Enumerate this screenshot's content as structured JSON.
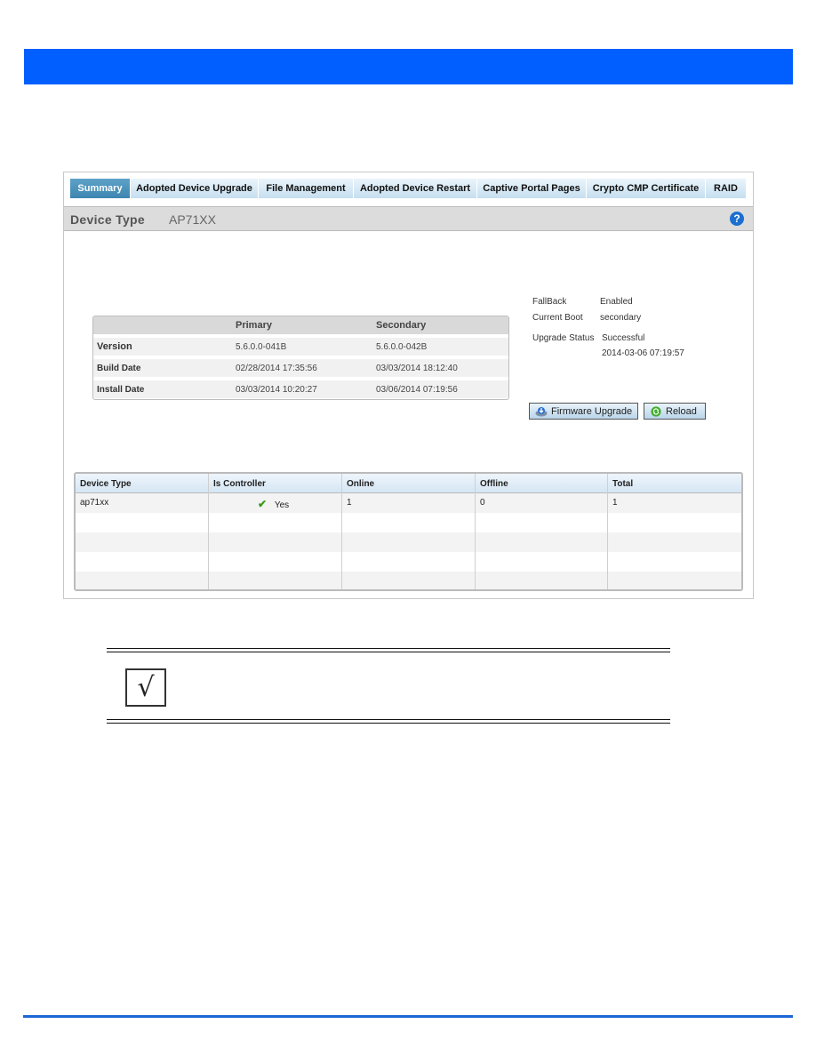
{
  "colors": {
    "header_bar": "#005ffe",
    "footer_rule": "#1c66d6",
    "active_tab": "#3d85b0",
    "help_icon": "#1b6fd1",
    "check_green": "#3a9a1c"
  },
  "tabs": [
    {
      "label": "Summary",
      "active": true
    },
    {
      "label": "Adopted Device Upgrade",
      "active": false
    },
    {
      "label": "File Management",
      "active": false
    },
    {
      "label": "Adopted Device Restart",
      "active": false
    },
    {
      "label": "Captive Portal Pages",
      "active": false
    },
    {
      "label": "Crypto CMP Certificate",
      "active": false
    },
    {
      "label": "RAID",
      "active": false
    }
  ],
  "device_header": {
    "label": "Device Type",
    "value": "AP71XX",
    "help_icon": "question-circle-icon"
  },
  "versions_table": {
    "columns": [
      "",
      "Primary",
      "Secondary"
    ],
    "rows": [
      [
        "Version",
        "5.6.0.0-041B",
        "5.6.0.0-042B"
      ],
      [
        "Build Date",
        "02/28/2014 17:35:56",
        "03/03/2014 18:12:40"
      ],
      [
        "Install Date",
        "03/03/2014 10:20:27",
        "03/06/2014 07:19:56"
      ]
    ]
  },
  "status": {
    "fallback_label": "FallBack",
    "fallback_value": "Enabled",
    "current_boot_label": "Current Boot",
    "current_boot_value": "secondary",
    "upgrade_status_label": "Upgrade Status",
    "upgrade_status_value": "Successful",
    "upgrade_timestamp": "2014-03-06 07:19:57"
  },
  "buttons": {
    "firmware_upgrade": "Firmware Upgrade",
    "reload": "Reload"
  },
  "device_table": {
    "columns": [
      "Device Type",
      "Is Controller",
      "Online",
      "Offline",
      "Total"
    ],
    "rows": [
      {
        "device_type": "ap71xx",
        "is_controller": "Yes",
        "online": "1",
        "offline": "0",
        "total": "1"
      }
    ]
  },
  "note": {
    "icon": "checkmark-icon",
    "glyph": "√"
  }
}
